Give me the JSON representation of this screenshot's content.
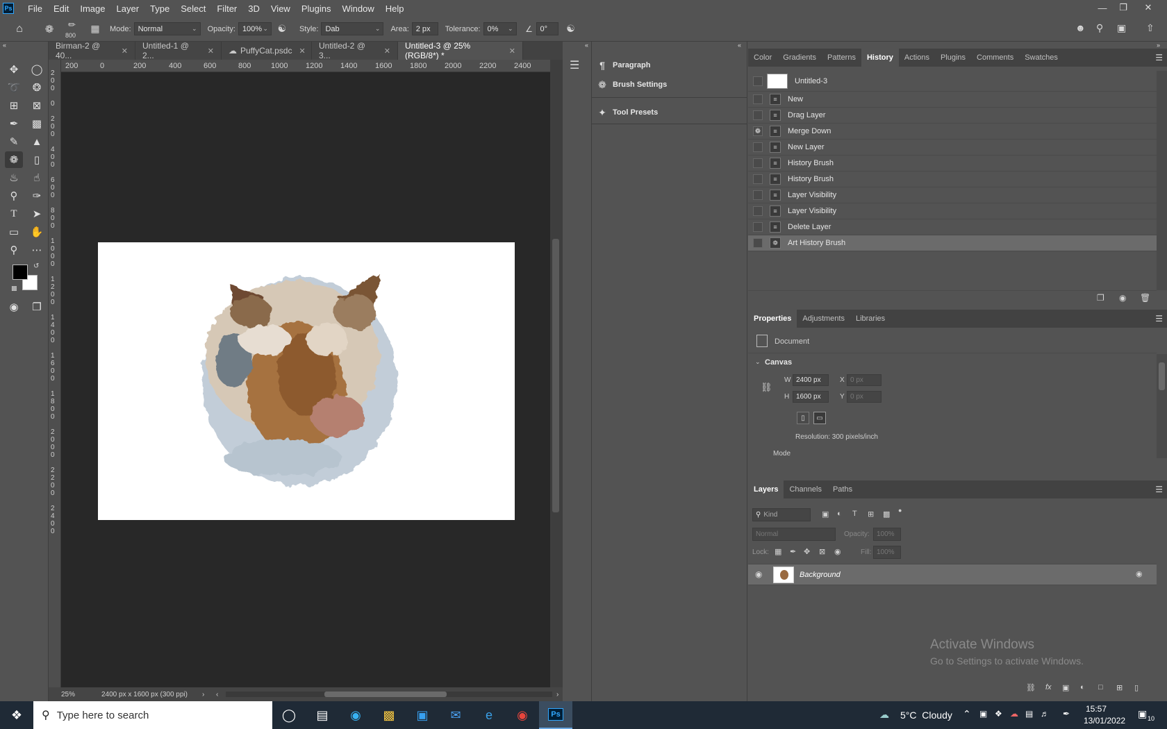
{
  "menu": [
    "File",
    "Edit",
    "Image",
    "Layer",
    "Type",
    "Select",
    "Filter",
    "3D",
    "View",
    "Plugins",
    "Window",
    "Help"
  ],
  "app_logo": "Ps",
  "options": {
    "brush_size": "800",
    "mode_label": "Mode:",
    "mode_value": "Normal",
    "opacity_label": "Opacity:",
    "opacity_value": "100%",
    "style_label": "Style:",
    "style_value": "Dab",
    "area_label": "Area:",
    "area_value": "2 px",
    "tolerance_label": "Tolerance:",
    "tolerance_value": "0%",
    "angle_value": "0°"
  },
  "doc_tabs": [
    {
      "label": "Birman-2 @ 40..."
    },
    {
      "label": "Untitled-1 @ 2..."
    },
    {
      "label": "PuffyCat.psdc"
    },
    {
      "label": "Untitled-2 @ 3..."
    },
    {
      "label": "Untitled-3 @ 25% (RGB/8*) *"
    }
  ],
  "ruler_top": [
    "200",
    "0",
    "200",
    "400",
    "600",
    "800",
    "1000",
    "1200",
    "1400",
    "1600",
    "1800",
    "2000",
    "2200",
    "2400"
  ],
  "status": {
    "zoom": "25%",
    "doc_info": "2400 px x 1600 px (300 ppi)"
  },
  "dock2": [
    {
      "label": "Paragraph",
      "icon": "paragraph-icon"
    },
    {
      "label": "Brush Settings",
      "icon": "brush-settings-icon"
    },
    {
      "label": "Tool Presets",
      "icon": "tool-presets-icon"
    }
  ],
  "top_tabs": [
    "Color",
    "Gradients",
    "Patterns",
    "History",
    "Actions",
    "Plugins",
    "Comments",
    "Swatches"
  ],
  "history": {
    "snapshot": "Untitled-3",
    "items": [
      "New",
      "Drag Layer",
      "Merge Down",
      "New Layer",
      "History Brush",
      "History Brush",
      "Layer Visibility",
      "Layer Visibility",
      "Delete Layer",
      "Art History Brush"
    ]
  },
  "props_tabs": [
    "Properties",
    "Adjustments",
    "Libraries"
  ],
  "props": {
    "doc_label": "Document",
    "canvas_label": "Canvas",
    "w_label": "W",
    "w_value": "2400 px",
    "h_label": "H",
    "h_value": "1600 px",
    "x_label": "X",
    "x_value": "0 px",
    "y_label": "Y",
    "y_value": "0 px",
    "resolution": "Resolution: 300 pixels/inch",
    "mode_label": "Mode"
  },
  "layers_tabs": [
    "Layers",
    "Channels",
    "Paths"
  ],
  "layers": {
    "kind_placeholder": "Kind",
    "blend": "Normal",
    "opacity_label": "Opacity:",
    "opacity_value": "100%",
    "lock_label": "Lock:",
    "fill_label": "Fill:",
    "fill_value": "100%",
    "layer_name": "Background"
  },
  "watermark": {
    "line1": "Activate Windows",
    "line2": "Go to Settings to activate Windows."
  },
  "taskbar": {
    "search_placeholder": "Type here to search",
    "weather": "5°C  Cloudy",
    "time": "15:57",
    "date": "13/01/2022",
    "notif_count": "10"
  }
}
